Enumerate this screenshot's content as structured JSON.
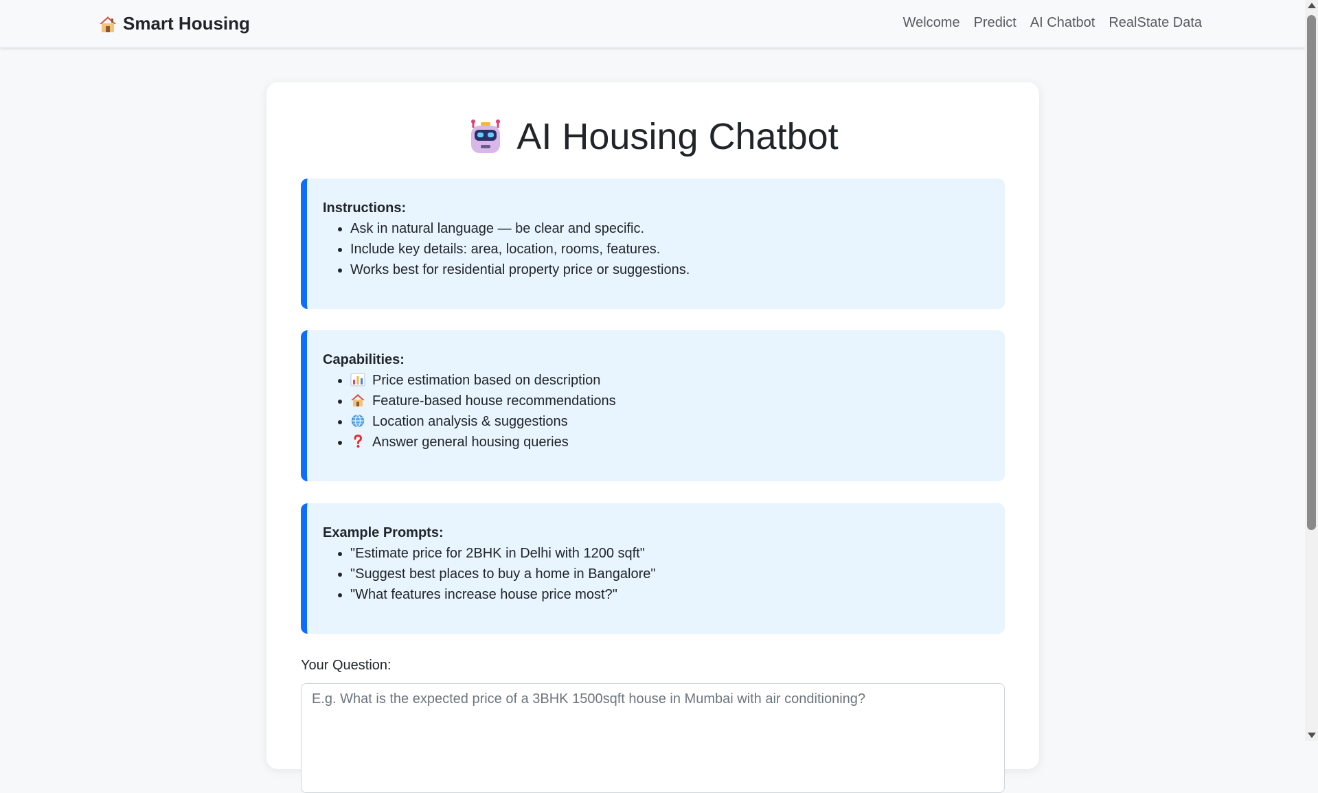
{
  "navbar": {
    "brand": "Smart Housing",
    "brand_icon": "house-icon",
    "links": [
      "Welcome",
      "Predict",
      "AI Chatbot",
      "RealState Data"
    ]
  },
  "main": {
    "title": "AI Housing Chatbot",
    "title_icon": "robot-icon",
    "instructions": {
      "title": "Instructions:",
      "items": [
        "Ask in natural language — be clear and specific.",
        "Include key details: area, location, rooms, features.",
        "Works best for residential property price or suggestions."
      ]
    },
    "capabilities": {
      "title": "Capabilities:",
      "items": [
        {
          "icon": "bar-chart-icon",
          "text": "Price estimation based on description"
        },
        {
          "icon": "house-icon",
          "text": "Feature-based house recommendations"
        },
        {
          "icon": "globe-icon",
          "text": "Location analysis & suggestions"
        },
        {
          "icon": "question-mark-icon",
          "text": "Answer general housing queries"
        }
      ]
    },
    "examples": {
      "title": "Example Prompts:",
      "items": [
        "\"Estimate price for 2BHK in Delhi with 1200 sqft\"",
        "\"Suggest best places to buy a home in Bangalore\"",
        "\"What features increase house price most?\""
      ]
    },
    "question": {
      "label": "Your Question:",
      "value": "",
      "placeholder": "E.g. What is the expected price of a 3BHK 1500sqft house in Mumbai with air conditioning?"
    }
  },
  "colors": {
    "accent": "#0d6efd",
    "info_bg": "#e8f4fe",
    "page_bg": "#f6f8fa"
  }
}
